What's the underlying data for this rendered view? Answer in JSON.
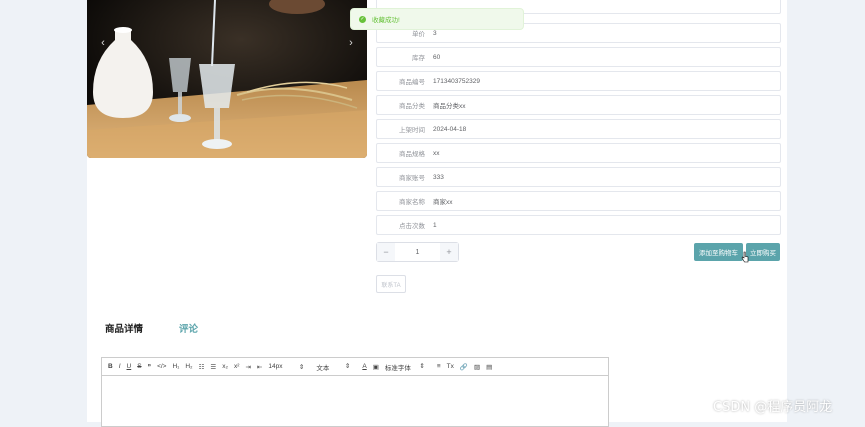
{
  "toast": {
    "text": "收藏成功!",
    "color": "#67c23a"
  },
  "carousel": {
    "prev_glyph": "‹",
    "next_glyph": "›"
  },
  "details": [
    {
      "label": "单价",
      "value": "3"
    },
    {
      "label": "库存",
      "value": "60"
    },
    {
      "label": "商品编号",
      "value": "1713403752329"
    },
    {
      "label": "商品分类",
      "value": "商品分类xx"
    },
    {
      "label": "上架时间",
      "value": "2024-04-18"
    },
    {
      "label": "商品规格",
      "value": "xx"
    },
    {
      "label": "商家账号",
      "value": "333"
    },
    {
      "label": "商家名称",
      "value": "商家xx"
    },
    {
      "label": "点击次数",
      "value": "1"
    }
  ],
  "quantity": {
    "minus": "−",
    "value": "1",
    "plus": "+"
  },
  "actions": {
    "add_cart": "添加至购物车",
    "buy_now": "立即购买",
    "contact": "联系TA"
  },
  "tabs": [
    {
      "label": "商品详情",
      "color": "#222222"
    },
    {
      "label": "评论",
      "color": "#5ba4ab"
    }
  ],
  "editor_toolbar": {
    "bold": "B",
    "italic": "I",
    "underline": "U",
    "strike": "S",
    "quote": "❞",
    "code": "</>",
    "h1": "H₁",
    "h2": "H₂",
    "ordered_list": "☷",
    "bullet_list": "☰",
    "subscript": "x₂",
    "superscript": "x²",
    "indent_in": "⇥",
    "indent_out": "⇤",
    "font_size": "14px",
    "text_type": "文本",
    "font_family": "标准字体",
    "color": "A",
    "background": "▣",
    "align": "≡",
    "clear": "Tx",
    "link": "🔗",
    "image": "▨",
    "video": "▤"
  },
  "watermark": "CSDN @程序员阿龙",
  "accent": "#5ba4ab"
}
